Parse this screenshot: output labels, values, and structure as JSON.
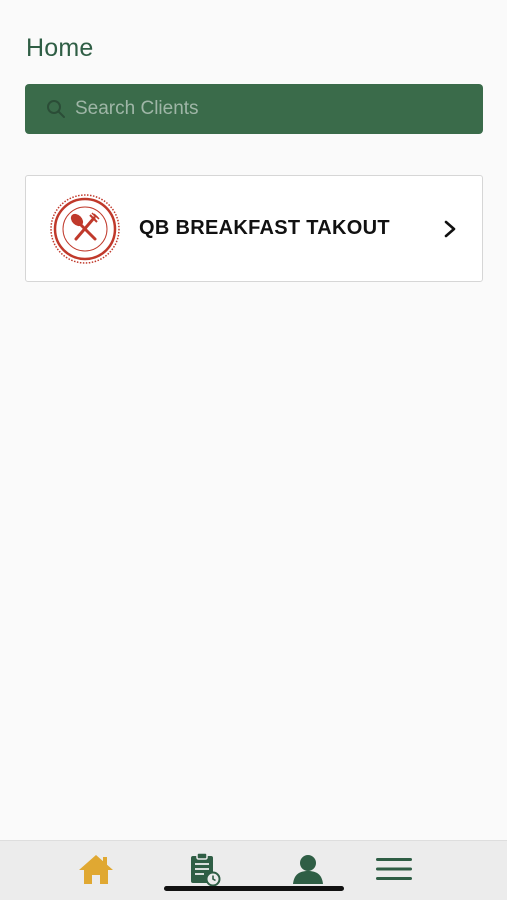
{
  "header": {
    "title": "Home"
  },
  "search": {
    "placeholder": "Search Clients",
    "value": ""
  },
  "clients": [
    {
      "name": "QB BREAKFAST TAKOUT",
      "logo_icon": "fork-spoon-icon"
    }
  ],
  "tabbar": {
    "items": [
      {
        "icon": "home-icon",
        "active": true
      },
      {
        "icon": "clipboard-clock-icon",
        "active": false
      },
      {
        "icon": "user-icon",
        "active": false
      },
      {
        "icon": "menu-icon",
        "active": false
      }
    ]
  },
  "colors": {
    "accent": "#2f5e45",
    "search_bg": "#3a6b4a",
    "active_tab": "#e0a832",
    "logo_red": "#c0392b",
    "background": "#fafafa"
  }
}
